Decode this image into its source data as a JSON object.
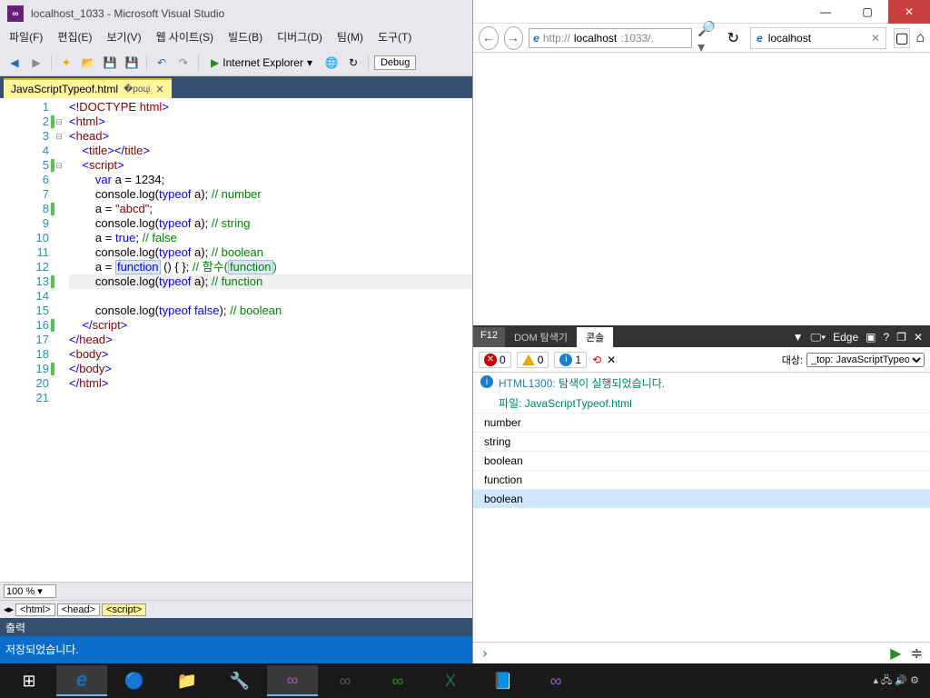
{
  "vs": {
    "title": "localhost_1033 - Microsoft Visual Studio",
    "menu": [
      "파일(F)",
      "편집(E)",
      "보기(V)",
      "웹 사이트(S)",
      "빌드(B)",
      "디버그(D)",
      "팀(M)",
      "도구(T)"
    ],
    "toolbar": {
      "run": "Internet Explorer",
      "debug": "Debug"
    },
    "tab": {
      "name": "JavaScriptTypeof.html"
    },
    "code": {
      "lines": [
        {
          "n": 1,
          "mark": false,
          "fold": "",
          "parts": [
            {
              "t": "<!",
              "c": "c-blue"
            },
            {
              "t": "DOCTYPE",
              "c": "c-maroon"
            },
            {
              "t": " ",
              "c": ""
            },
            {
              "t": "html",
              "c": "c-red"
            },
            {
              "t": ">",
              "c": "c-blue"
            }
          ]
        },
        {
          "n": 2,
          "mark": true,
          "fold": "⊟",
          "parts": [
            {
              "t": "<",
              "c": "c-blue"
            },
            {
              "t": "html",
              "c": "c-maroon"
            },
            {
              "t": ">",
              "c": "c-blue"
            }
          ]
        },
        {
          "n": 3,
          "mark": false,
          "fold": "⊟",
          "parts": [
            {
              "t": "<",
              "c": "c-blue"
            },
            {
              "t": "head",
              "c": "c-maroon"
            },
            {
              "t": ">",
              "c": "c-blue"
            }
          ]
        },
        {
          "n": 4,
          "mark": false,
          "fold": "",
          "parts": [
            {
              "t": "    ",
              "c": ""
            },
            {
              "t": "<",
              "c": "c-blue"
            },
            {
              "t": "title",
              "c": "c-maroon"
            },
            {
              "t": "></",
              "c": "c-blue"
            },
            {
              "t": "title",
              "c": "c-maroon"
            },
            {
              "t": ">",
              "c": "c-blue"
            }
          ]
        },
        {
          "n": 5,
          "mark": true,
          "fold": "⊟",
          "parts": [
            {
              "t": "    ",
              "c": ""
            },
            {
              "t": "<",
              "c": "c-blue"
            },
            {
              "t": "script",
              "c": "c-maroon"
            },
            {
              "t": ">",
              "c": "c-blue"
            }
          ]
        },
        {
          "n": 6,
          "mark": false,
          "fold": "",
          "parts": [
            {
              "t": "        ",
              "c": ""
            },
            {
              "t": "var",
              "c": "c-blue"
            },
            {
              "t": " a = 1234;",
              "c": "c-black"
            }
          ]
        },
        {
          "n": 7,
          "mark": false,
          "fold": "",
          "parts": [
            {
              "t": "        console.log(",
              "c": "c-black"
            },
            {
              "t": "typeof",
              "c": "c-blue"
            },
            {
              "t": " a); ",
              "c": "c-black"
            },
            {
              "t": "// number",
              "c": "c-green"
            }
          ]
        },
        {
          "n": 8,
          "mark": true,
          "fold": "",
          "parts": [
            {
              "t": "        a = ",
              "c": "c-black"
            },
            {
              "t": "\"abcd\"",
              "c": "c-maroon"
            },
            {
              "t": ";",
              "c": "c-black"
            }
          ]
        },
        {
          "n": 9,
          "mark": false,
          "fold": "",
          "parts": [
            {
              "t": "        console.log(",
              "c": "c-black"
            },
            {
              "t": "typeof",
              "c": "c-blue"
            },
            {
              "t": " a); ",
              "c": "c-black"
            },
            {
              "t": "// string",
              "c": "c-green"
            }
          ]
        },
        {
          "n": 10,
          "mark": false,
          "fold": "",
          "parts": [
            {
              "t": "        a = ",
              "c": "c-black"
            },
            {
              "t": "true",
              "c": "c-blue"
            },
            {
              "t": "; ",
              "c": "c-black"
            },
            {
              "t": "// false",
              "c": "c-green"
            }
          ]
        },
        {
          "n": 11,
          "mark": false,
          "fold": "",
          "parts": [
            {
              "t": "        console.log(",
              "c": "c-black"
            },
            {
              "t": "typeof",
              "c": "c-blue"
            },
            {
              "t": " a); ",
              "c": "c-black"
            },
            {
              "t": "// boolean",
              "c": "c-green"
            }
          ]
        },
        {
          "n": 12,
          "mark": false,
          "fold": "",
          "hl": false,
          "parts": [
            {
              "t": "        a = ",
              "c": "c-black"
            },
            {
              "t": "function",
              "c": "c-blue",
              "hlw": true
            },
            {
              "t": " () { }; ",
              "c": "c-black"
            },
            {
              "t": "// 함수(",
              "c": "c-green"
            },
            {
              "t": "function",
              "c": "c-green",
              "hlw": true
            },
            {
              "t": ")",
              "c": "c-green"
            }
          ]
        },
        {
          "n": 13,
          "mark": true,
          "fold": "",
          "hl": true,
          "parts": [
            {
              "t": "        console.log(",
              "c": "c-black"
            },
            {
              "t": "typeof",
              "c": "c-blue"
            },
            {
              "t": " a); ",
              "c": "c-black"
            },
            {
              "t": "// function",
              "c": "c-green"
            }
          ]
        },
        {
          "n": 14,
          "mark": false,
          "fold": "",
          "parts": []
        },
        {
          "n": 15,
          "mark": false,
          "fold": "",
          "parts": [
            {
              "t": "        console.log(",
              "c": "c-black"
            },
            {
              "t": "typeof",
              "c": "c-blue"
            },
            {
              "t": " ",
              "c": ""
            },
            {
              "t": "false",
              "c": "c-blue"
            },
            {
              "t": "); ",
              "c": "c-black"
            },
            {
              "t": "// boolean",
              "c": "c-green"
            }
          ]
        },
        {
          "n": 16,
          "mark": true,
          "fold": "",
          "parts": [
            {
              "t": "    ",
              "c": ""
            },
            {
              "t": "</",
              "c": "c-blue"
            },
            {
              "t": "script",
              "c": "c-maroon"
            },
            {
              "t": ">",
              "c": "c-blue"
            }
          ]
        },
        {
          "n": 17,
          "mark": false,
          "fold": "",
          "parts": [
            {
              "t": "</",
              "c": "c-blue"
            },
            {
              "t": "head",
              "c": "c-maroon"
            },
            {
              "t": ">",
              "c": "c-blue"
            }
          ]
        },
        {
          "n": 18,
          "mark": false,
          "fold": "",
          "parts": [
            {
              "t": "<",
              "c": "c-blue"
            },
            {
              "t": "body",
              "c": "c-maroon"
            },
            {
              "t": ">",
              "c": "c-blue"
            }
          ]
        },
        {
          "n": 19,
          "mark": true,
          "fold": "",
          "parts": [
            {
              "t": "</",
              "c": "c-blue"
            },
            {
              "t": "body",
              "c": "c-maroon"
            },
            {
              "t": ">",
              "c": "c-blue"
            }
          ]
        },
        {
          "n": 20,
          "mark": false,
          "fold": "",
          "parts": [
            {
              "t": "</",
              "c": "c-blue"
            },
            {
              "t": "html",
              "c": "c-maroon"
            },
            {
              "t": ">",
              "c": "c-blue"
            }
          ]
        },
        {
          "n": 21,
          "mark": false,
          "fold": "",
          "parts": []
        }
      ]
    },
    "zoom": "100 %",
    "breadcrumb": [
      "<html>",
      "<head>",
      "<script>"
    ],
    "output": {
      "header": "출력",
      "body": "저장되었습니다."
    }
  },
  "ie": {
    "url_prefix": "http://",
    "url_host": "localhost",
    "url_rest": ":1033/.",
    "tab": "localhost",
    "devtools": {
      "f12": "F12",
      "tabs": [
        "DOM 탐색기",
        "콘솔"
      ],
      "edge": "Edge",
      "errors": "0",
      "warnings": "0",
      "info": "1",
      "target_label": "대상:",
      "target_value": "_top: JavaScriptTypeof.h",
      "msg_code": "HTML1300",
      "msg_text": ": 탐색이 실행되었습니다.",
      "file_label": "파일: ",
      "file_name": "JavaScriptTypeof.html",
      "logs": [
        "number",
        "string",
        "boolean",
        "function",
        "boolean"
      ]
    }
  }
}
